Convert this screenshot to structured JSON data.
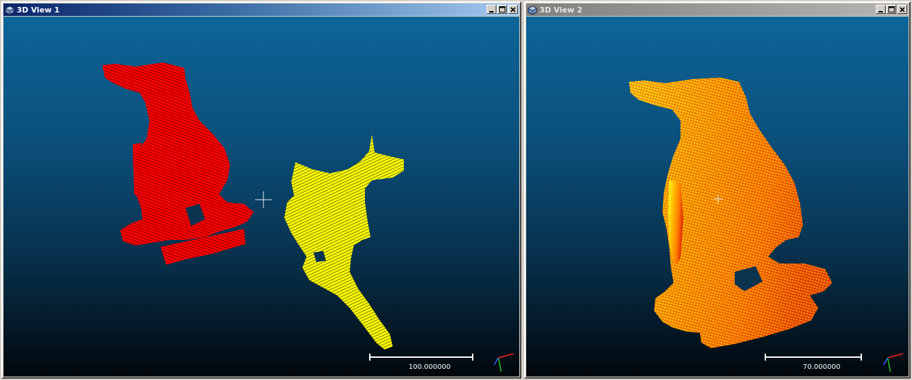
{
  "windows": [
    {
      "title": "3D View 1",
      "scale_label": "100.000000",
      "state": "active"
    },
    {
      "title": "3D View 2",
      "scale_label": "70.000000",
      "state": "inactive"
    }
  ],
  "colors": {
    "background_top": "#0d6599",
    "background_bottom": "#01070b",
    "cloud_red": "#ff0000",
    "cloud_yellow": "#ffff00",
    "axis_x": "#ff2020",
    "axis_y": "#20c020",
    "axis_z": "#3060ff"
  },
  "icons": {
    "window_icon": "3d-cube-icon",
    "minimize": "minimize-icon",
    "maximize": "maximize-icon",
    "close": "close-icon",
    "crosshair": "pivot-crosshair-icon",
    "axes": "axis-trihedron-icon"
  }
}
